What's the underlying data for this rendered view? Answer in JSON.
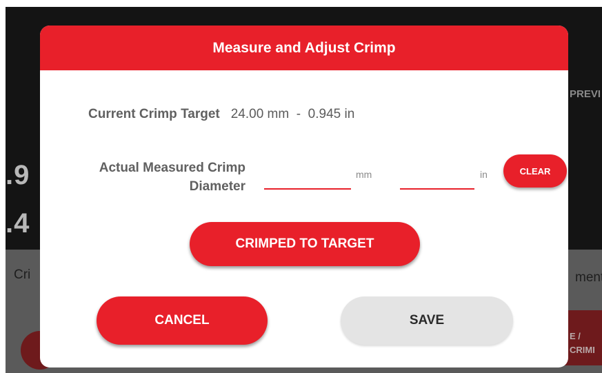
{
  "background": {
    "prev_label": "PREVI",
    "big_value_1": ".9",
    "big_value_2": ".4",
    "section_left": "Cri",
    "section_right": "ment",
    "button_fragment": "E /\nCRIMI"
  },
  "dialog": {
    "title": "Measure and Adjust Crimp",
    "current_target_label": "Current Crimp Target",
    "current_target_value": "24.00 mm  -  0.945 in",
    "measured_label": "Actual Measured Crimp Diameter",
    "mm_value": "",
    "mm_unit": "mm",
    "in_value": "",
    "in_unit": "in",
    "clear_label": "CLEAR",
    "crimped_to_target_label": "CRIMPED TO TARGET",
    "cancel_label": "CANCEL",
    "save_label": "SAVE"
  },
  "colors": {
    "accent": "#e8202a",
    "save_button": "#e4e4e4",
    "label_text": "#606060"
  }
}
